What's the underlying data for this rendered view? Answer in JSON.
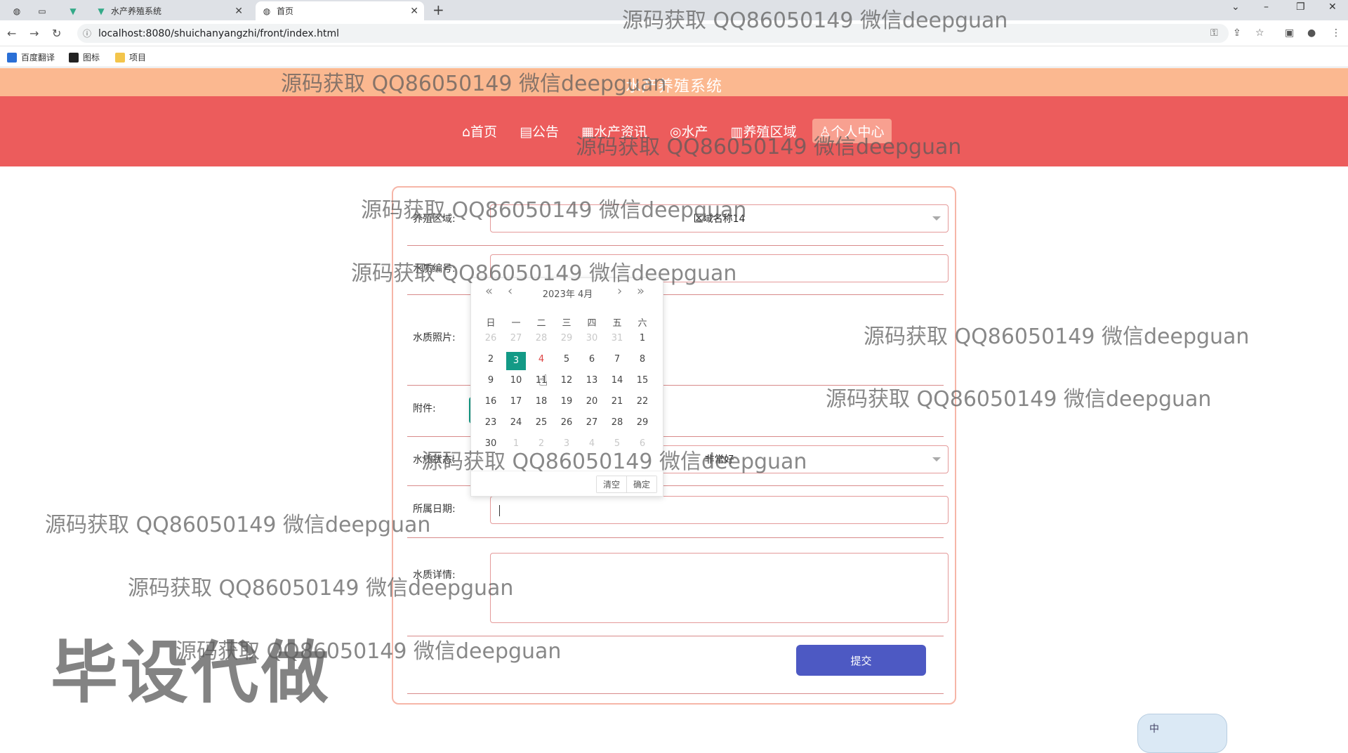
{
  "browser": {
    "tabs": [
      {
        "label": ""
      },
      {
        "label": "水产养殖系统"
      },
      {
        "label": "首页"
      }
    ],
    "url": "localhost:8080/shuichanyangzhi/front/index.html",
    "bookmarks": [
      "百度翻译",
      "图标",
      "项目"
    ]
  },
  "site": {
    "title": "水产养殖系统",
    "nav": [
      "⌂首页",
      "▤公告",
      "▦水产资讯",
      "◎水产",
      "▥养殖区域",
      "♙个人中心"
    ]
  },
  "form": {
    "area_label": "养殖区域:",
    "area_value": "区域名称14",
    "code_label": "水质编号:",
    "photo_label": "水质照片:",
    "attachment_label": "附件:",
    "quality_label": "水质状态:",
    "quality_value": "非常好",
    "date_label": "所属日期:",
    "detail_label": "水质详情:",
    "submit": "提交"
  },
  "calendar": {
    "title": "2023年  4月",
    "weekdays": [
      "日",
      "一",
      "二",
      "三",
      "四",
      "五",
      "六"
    ],
    "days": [
      [
        "26",
        "27",
        "28",
        "29",
        "30",
        "31",
        "1"
      ],
      [
        "2",
        "3",
        "4",
        "5",
        "6",
        "7",
        "8"
      ],
      [
        "9",
        "10",
        "11",
        "12",
        "13",
        "14",
        "15"
      ],
      [
        "16",
        "17",
        "18",
        "19",
        "20",
        "21",
        "22"
      ],
      [
        "23",
        "24",
        "25",
        "26",
        "27",
        "28",
        "29"
      ],
      [
        "30",
        "1",
        "2",
        "3",
        "4",
        "5",
        "6"
      ]
    ],
    "selected": "3",
    "hovered": "4",
    "clear": "清空",
    "confirm": "确定"
  },
  "overlays": {
    "watermark": "源码获取 QQ86050149 微信deepguan",
    "big": "毕设代做",
    "ime": "中"
  }
}
